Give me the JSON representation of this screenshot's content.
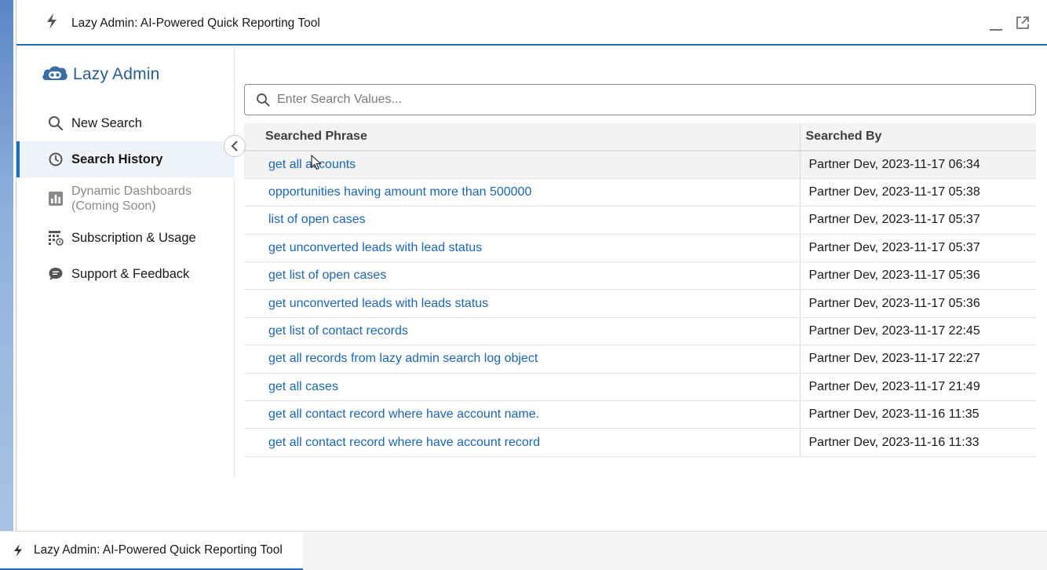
{
  "window": {
    "title": "Lazy Admin: AI-Powered Quick Reporting Tool"
  },
  "brand": {
    "name": "Lazy Admin"
  },
  "sidebar": {
    "items": [
      {
        "label": "New Search",
        "icon": "search-icon"
      },
      {
        "label": "Search History",
        "icon": "clock-icon",
        "active": true
      },
      {
        "label": "Dynamic Dashboards",
        "sublabel": "(Coming Soon)",
        "icon": "bar-chart-icon",
        "disabled": true
      },
      {
        "label": "Subscription & Usage",
        "icon": "calendar-grid-icon"
      },
      {
        "label": "Support & Feedback",
        "icon": "chat-icon"
      }
    ]
  },
  "search": {
    "placeholder": "Enter Search Values..."
  },
  "table": {
    "columns": [
      "Searched Phrase",
      "Searched By"
    ],
    "rows": [
      {
        "phrase": "get all accounts",
        "by": "Partner Dev, 2023-11-17 06:34"
      },
      {
        "phrase": "opportunities having amount more than 500000",
        "by": "Partner Dev, 2023-11-17 05:38"
      },
      {
        "phrase": "list of open cases",
        "by": "Partner Dev, 2023-11-17 05:37"
      },
      {
        "phrase": "get unconverted leads with lead status",
        "by": "Partner Dev, 2023-11-17 05:37"
      },
      {
        "phrase": "get list of open cases",
        "by": "Partner Dev, 2023-11-17 05:36"
      },
      {
        "phrase": "get unconverted leads with leads status",
        "by": "Partner Dev, 2023-11-17 05:36"
      },
      {
        "phrase": "get list of contact records",
        "by": "Partner Dev, 2023-11-17 22:45"
      },
      {
        "phrase": "get all records from lazy admin search log object",
        "by": "Partner Dev, 2023-11-17 22:27"
      },
      {
        "phrase": "get all cases",
        "by": "Partner Dev, 2023-11-17 21:49"
      },
      {
        "phrase": "get all contact record where have account name.",
        "by": "Partner Dev, 2023-11-16 11:35"
      },
      {
        "phrase": "get all contact record where have account record",
        "by": "Partner Dev, 2023-11-16 11:33"
      }
    ]
  },
  "taskbar": {
    "tab_label": "Lazy Admin: AI-Powered Quick Reporting Tool"
  },
  "colors": {
    "accent": "#1b6fc2",
    "link": "#1b66b5",
    "brand": "#2a5d8f"
  }
}
